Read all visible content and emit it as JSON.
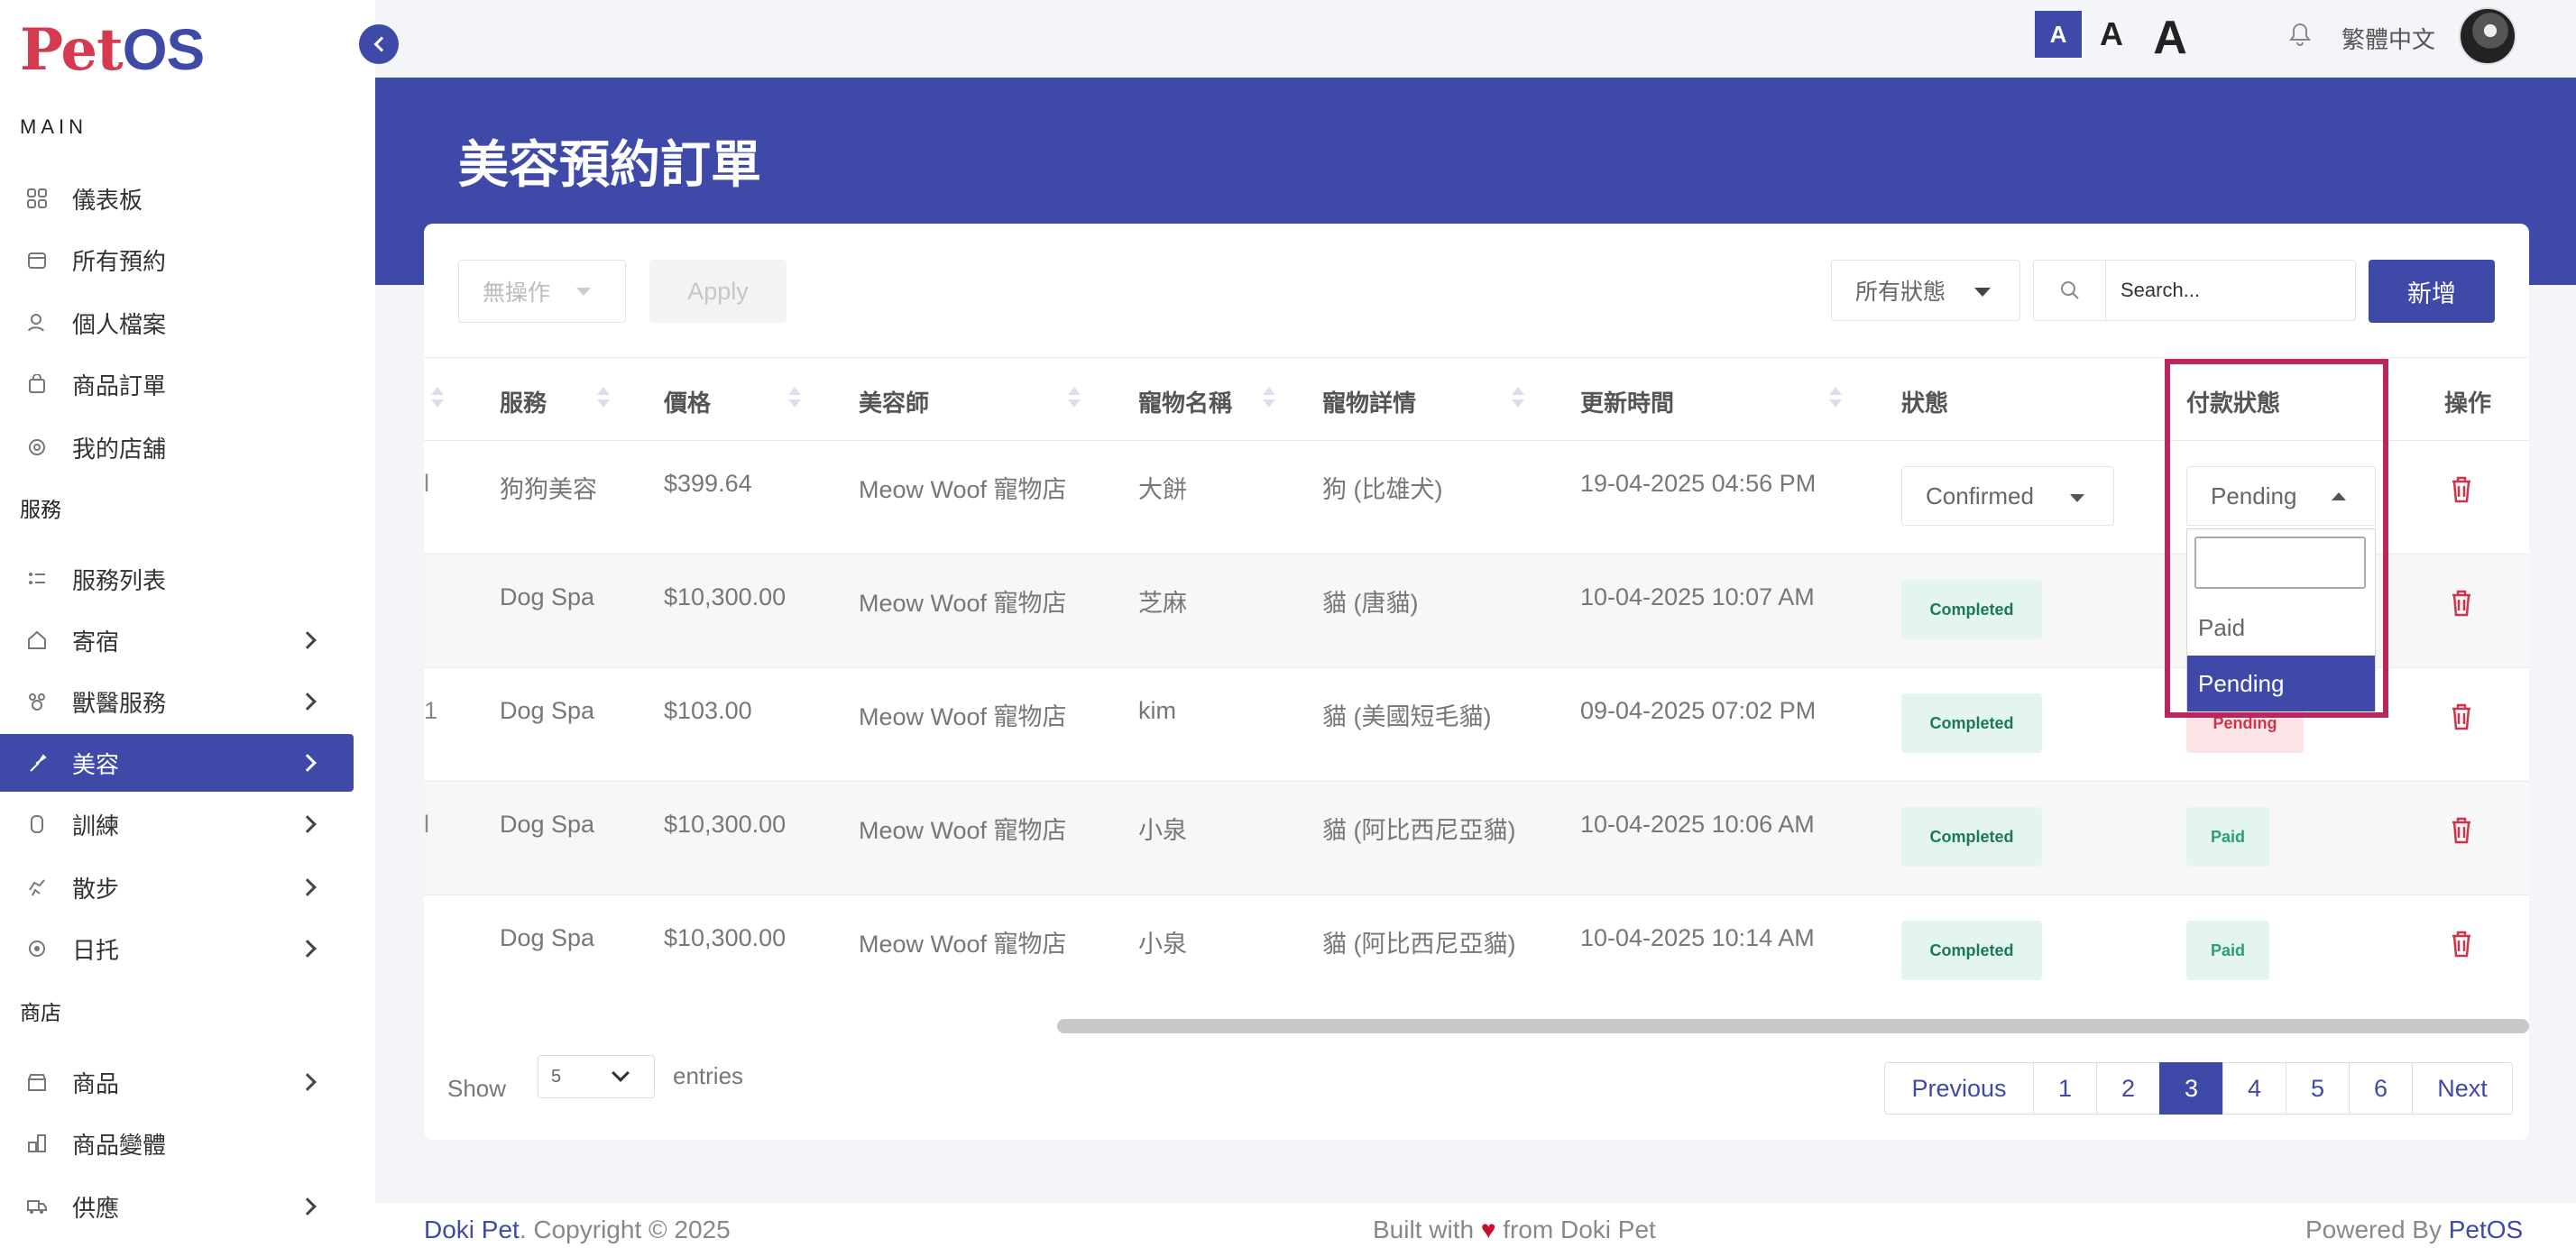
{
  "brand": {
    "logo_p": "P",
    "logo_et": "et",
    "logo_os": "OS"
  },
  "sidebar": {
    "sections": {
      "main": "MAIN",
      "services": "服務",
      "shop": "商店"
    },
    "main_items": [
      {
        "label": "儀表板",
        "icon": "dashboard-icon"
      },
      {
        "label": "所有預約",
        "icon": "calendar-icon"
      },
      {
        "label": "個人檔案",
        "icon": "user-icon"
      },
      {
        "label": "商品訂單",
        "icon": "bag-icon"
      },
      {
        "label": "我的店舖",
        "icon": "shop-icon"
      }
    ],
    "service_items": [
      {
        "label": "服務列表",
        "icon": "list-icon"
      },
      {
        "label": "寄宿",
        "icon": "house-icon"
      },
      {
        "label": "獸醫服務",
        "icon": "vet-icon"
      },
      {
        "label": "美容",
        "icon": "brush-icon",
        "active": true
      },
      {
        "label": "訓練",
        "icon": "training-icon"
      },
      {
        "label": "散步",
        "icon": "walk-icon"
      },
      {
        "label": "日托",
        "icon": "daycare-icon"
      }
    ],
    "shop_items": [
      {
        "label": "商品",
        "icon": "store-icon"
      },
      {
        "label": "商品變體",
        "icon": "variant-icon"
      },
      {
        "label": "供應",
        "icon": "truck-icon"
      }
    ]
  },
  "topbar": {
    "font_small": "A",
    "font_medium": "A",
    "font_large": "A",
    "language": "繁體中文"
  },
  "page": {
    "title": "美容預約訂單"
  },
  "toolbar": {
    "bulk_action": "無操作",
    "apply_label": "Apply",
    "status_filter": "所有狀態",
    "search_placeholder": "Search...",
    "add_label": "新增"
  },
  "table": {
    "headers": {
      "service": "服務",
      "price": "價格",
      "groomer": "美容師",
      "pet_name": "寵物名稱",
      "pet_detail": "寵物詳情",
      "updated": "更新時間",
      "status": "狀態",
      "payment": "付款狀態",
      "actions": "操作"
    },
    "rows": [
      {
        "service": "狗狗美容",
        "price": "$399.64",
        "groomer": "Meow Woof 寵物店",
        "pet_name": "大餅",
        "pet_detail": "狗 (比雄犬)",
        "updated": "19-04-2025 04:56 PM",
        "status": "Confirmed",
        "payment": "Pending"
      },
      {
        "service": "Dog Spa",
        "price": "$10,300.00",
        "groomer": "Meow Woof 寵物店",
        "pet_name": "芝麻",
        "pet_detail": "貓 (唐貓)",
        "updated": "10-04-2025 10:07 AM",
        "status": "Completed",
        "payment": ""
      },
      {
        "service": "Dog Spa",
        "price": "$103.00",
        "groomer": "Meow Woof 寵物店",
        "pet_name": "kim",
        "pet_detail": "貓 (美國短毛貓)",
        "updated": "09-04-2025 07:02 PM",
        "status": "Completed",
        "payment": "Pending"
      },
      {
        "service": "Dog Spa",
        "price": "$10,300.00",
        "groomer": "Meow Woof 寵物店",
        "pet_name": "小泉",
        "pet_detail": "貓 (阿比西尼亞貓)",
        "updated": "10-04-2025 10:06 AM",
        "status": "Completed",
        "payment": "Paid"
      },
      {
        "service": "Dog Spa",
        "price": "$10,300.00",
        "groomer": "Meow Woof 寵物店",
        "pet_name": "小泉",
        "pet_detail": "貓 (阿比西尼亞貓)",
        "updated": "10-04-2025 10:14 AM",
        "status": "Completed",
        "payment": "Paid"
      }
    ],
    "truncated_first_col": [
      "l",
      "",
      "1",
      "l",
      ""
    ]
  },
  "payment_dropdown": {
    "options": [
      "Paid",
      "Pending"
    ],
    "selected": "Pending"
  },
  "pagination": {
    "show_label": "Show",
    "entries_value": "5",
    "entries_label": "entries",
    "pages": [
      "Previous",
      "1",
      "2",
      "3",
      "4",
      "5",
      "6",
      "Next"
    ],
    "current": "3"
  },
  "footer": {
    "left_brand": "Doki Pet",
    "left_text": ". Copyright © 2025",
    "center_pre": "Built with ",
    "heart": "♥",
    "center_post": " from Doki Pet",
    "right_pre": "Powered By ",
    "right_brand": "PetOS"
  },
  "colors": {
    "primary": "#3f4aa8",
    "logo_red": "#d63a4f",
    "highlight": "#b8285e",
    "danger": "#d0344a",
    "success_bg": "#e3f5ee"
  }
}
